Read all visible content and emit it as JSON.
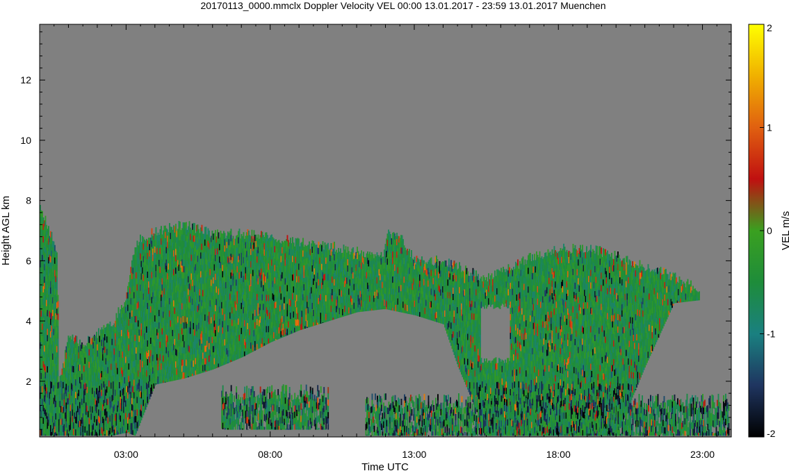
{
  "chart_data": {
    "type": "heatmap",
    "title": "20170113_0000.mmclx Doppler Velocity VEL   00:00 13.01.2017 - 23:59 13.01.2017 Muenchen",
    "xlabel": "Time UTC",
    "ylabel": "Height AGL km",
    "x_ticks": [
      "03:00",
      "08:00",
      "13:00",
      "18:00",
      "23:00"
    ],
    "x_tick_hours": [
      3,
      8,
      13,
      18,
      23
    ],
    "xlim_hours": [
      0,
      24
    ],
    "y_ticks": [
      "2",
      "4",
      "6",
      "8",
      "10",
      "12"
    ],
    "y_tick_values": [
      2,
      4,
      6,
      8,
      10,
      12
    ],
    "ylim_km": [
      0.15,
      13.85
    ],
    "colorbar": {
      "label": "VEL m/s",
      "ticks": [
        "2",
        "1",
        "0",
        "-1",
        "-2"
      ],
      "tick_values": [
        2,
        1,
        0,
        -1,
        -2
      ],
      "range": [
        -2,
        2
      ],
      "colors": [
        "#000000",
        "#1f3560",
        "#1a8080",
        "#1e8c3a",
        "#3aa020",
        "#c01010",
        "#e06010",
        "#f0b000",
        "#ffff00"
      ]
    },
    "background_color": "#808080",
    "cloud_echo_extent": [
      {
        "hour": 0.0,
        "base_km": 0.2,
        "top_km": 7.8
      },
      {
        "hour": 0.6,
        "base_km": 0.2,
        "top_km": 6.3
      },
      {
        "hour": 0.65,
        "base_km": 0.2,
        "top_km": 1.9
      },
      {
        "hour": 1.0,
        "base_km": 0.2,
        "top_km": 3.6
      },
      {
        "hour": 1.5,
        "base_km": 0.2,
        "top_km": 3.2
      },
      {
        "hour": 2.0,
        "base_km": 0.2,
        "top_km": 3.6
      },
      {
        "hour": 2.5,
        "base_km": 0.2,
        "top_km": 3.9
      },
      {
        "hour": 3.0,
        "base_km": 0.3,
        "top_km": 4.8
      },
      {
        "hour": 3.3,
        "base_km": 0.2,
        "top_km": 6.6
      },
      {
        "hour": 4.0,
        "base_km": 1.9,
        "top_km": 7.0
      },
      {
        "hour": 5.0,
        "base_km": 2.1,
        "top_km": 7.2
      },
      {
        "hour": 6.0,
        "base_km": 2.4,
        "top_km": 6.9
      },
      {
        "hour": 7.0,
        "base_km": 2.8,
        "top_km": 6.9
      },
      {
        "hour": 8.0,
        "base_km": 3.3,
        "top_km": 6.8
      },
      {
        "hour": 9.0,
        "base_km": 3.7,
        "top_km": 6.6
      },
      {
        "hour": 10.0,
        "base_km": 4.0,
        "top_km": 6.5
      },
      {
        "hour": 11.0,
        "base_km": 4.3,
        "top_km": 6.3
      },
      {
        "hour": 11.9,
        "base_km": 4.4,
        "top_km": 6.2
      },
      {
        "hour": 12.0,
        "base_km": 4.4,
        "top_km": 6.9
      },
      {
        "hour": 12.5,
        "base_km": 4.3,
        "top_km": 6.8
      },
      {
        "hour": 13.0,
        "base_km": 4.2,
        "top_km": 6.0
      },
      {
        "hour": 14.0,
        "base_km": 3.9,
        "top_km": 6.0
      },
      {
        "hour": 14.5,
        "base_km": 2.5,
        "top_km": 5.8
      },
      {
        "hour": 15.5,
        "base_km": 0.2,
        "top_km": 5.4
      },
      {
        "hour": 16.0,
        "base_km": 0.2,
        "top_km": 5.6
      },
      {
        "hour": 17.0,
        "base_km": 0.2,
        "top_km": 6.1
      },
      {
        "hour": 18.0,
        "base_km": 0.2,
        "top_km": 6.4
      },
      {
        "hour": 19.0,
        "base_km": 0.2,
        "top_km": 6.4
      },
      {
        "hour": 20.0,
        "base_km": 0.2,
        "top_km": 6.2
      },
      {
        "hour": 21.0,
        "base_km": 2.5,
        "top_km": 5.8
      },
      {
        "hour": 22.0,
        "base_km": 4.6,
        "top_km": 5.5
      },
      {
        "hour": 22.9,
        "base_km": 4.7,
        "top_km": 5.0
      }
    ],
    "low_cloud_extent": [
      {
        "hour_start": 11.3,
        "hour_end": 23.9,
        "base_km": 0.2,
        "top_km": 1.6
      },
      {
        "hour_start": 6.3,
        "hour_end": 10.0,
        "base_km": 0.4,
        "top_km": 1.9
      }
    ],
    "echo_free_hole": {
      "hour_start": 15.3,
      "hour_end": 16.3,
      "base_km": 2.8,
      "top_km": 4.6
    }
  }
}
